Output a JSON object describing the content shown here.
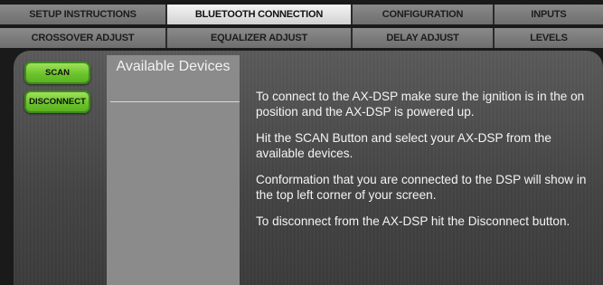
{
  "tabs_row1": [
    "SETUP INSTRUCTIONS",
    "BLUETOOTH CONNECTION",
    "CONFIGURATION",
    "INPUTS"
  ],
  "tabs_row2": [
    "CROSSOVER ADJUST",
    "EQUALIZER ADJUST",
    "DELAY ADJUST",
    "LEVELS"
  ],
  "active_tab": "BLUETOOTH CONNECTION",
  "buttons": {
    "scan": "SCAN",
    "disconnect": "DISCONNECT"
  },
  "devices": {
    "title": "Available Devices"
  },
  "instructions": [
    "To connect to the AX-DSP make sure the ignition is in the on position and the AX-DSP is powered up.",
    "Hit the SCAN Button and select your AX-DSP from the available devices.",
    "Conformation that you are connected to the DSP will show in the top left corner of your screen.",
    "To disconnect from the AX-DSP hit the Disconnect button."
  ],
  "colors": {
    "button_green": "#6cc42c",
    "active_tab": "#e8e8e8",
    "inactive_tab": "#7a7a7a"
  }
}
